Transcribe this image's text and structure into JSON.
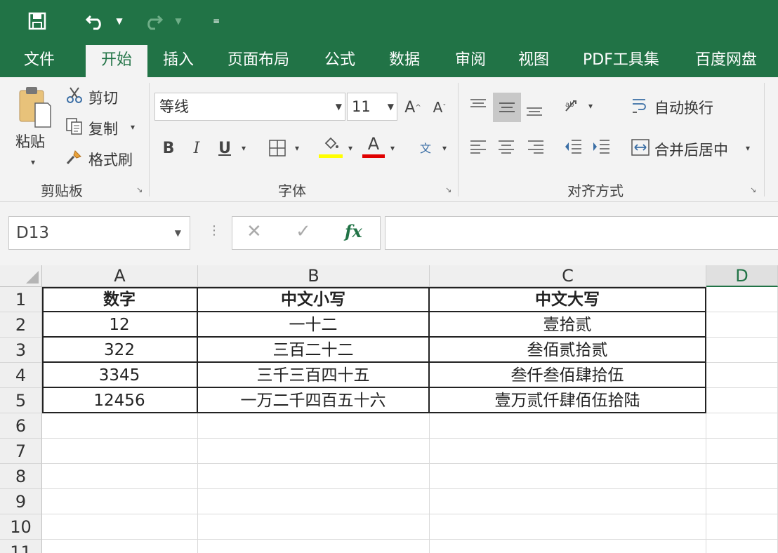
{
  "quick_access": {
    "save_icon": "save-icon",
    "undo_icon": "undo-icon",
    "redo_icon": "redo-icon",
    "customize_icon": "customize-qat-icon"
  },
  "tabs": [
    {
      "label": "文件"
    },
    {
      "label": "开始",
      "active": true
    },
    {
      "label": "插入"
    },
    {
      "label": "页面布局"
    },
    {
      "label": "公式"
    },
    {
      "label": "数据"
    },
    {
      "label": "审阅"
    },
    {
      "label": "视图"
    },
    {
      "label": "PDF工具集"
    },
    {
      "label": "百度网盘"
    }
  ],
  "ribbon": {
    "clipboard": {
      "paste": "粘贴",
      "cut": "剪切",
      "copy": "复制",
      "format_painter": "格式刷",
      "group_label": "剪贴板"
    },
    "font": {
      "font_name": "等线",
      "font_size": "11",
      "bold": "B",
      "italic": "I",
      "underline": "U",
      "font_color_letter": "A",
      "group_label": "字体",
      "highlight_color": "#ffff00",
      "font_color": "#e00000"
    },
    "alignment": {
      "wrap_text": "自动换行",
      "merge_center": "合并后居中",
      "group_label": "对齐方式"
    }
  },
  "formula_bar": {
    "name_box": "D13",
    "fx": "fx",
    "value": ""
  },
  "sheet": {
    "columns": [
      "A",
      "B",
      "C",
      "D"
    ],
    "selected_column": "D",
    "rows": [
      "1",
      "2",
      "3",
      "4",
      "5",
      "6",
      "7",
      "8",
      "9",
      "10",
      "11"
    ],
    "headers": [
      "数字",
      "中文小写",
      "中文大写"
    ],
    "data": [
      [
        "12",
        "一十二",
        "壹拾贰"
      ],
      [
        "322",
        "三百二十二",
        "叁佰贰拾贰"
      ],
      [
        "3345",
        "三千三百四十五",
        "叁仟叁佰肆拾伍"
      ],
      [
        "12456",
        "一万二千四百五十六",
        "壹万贰仟肆佰伍拾陆"
      ]
    ]
  },
  "colors": {
    "brand": "#217346",
    "ribbon_bg": "#f3f3f3"
  }
}
